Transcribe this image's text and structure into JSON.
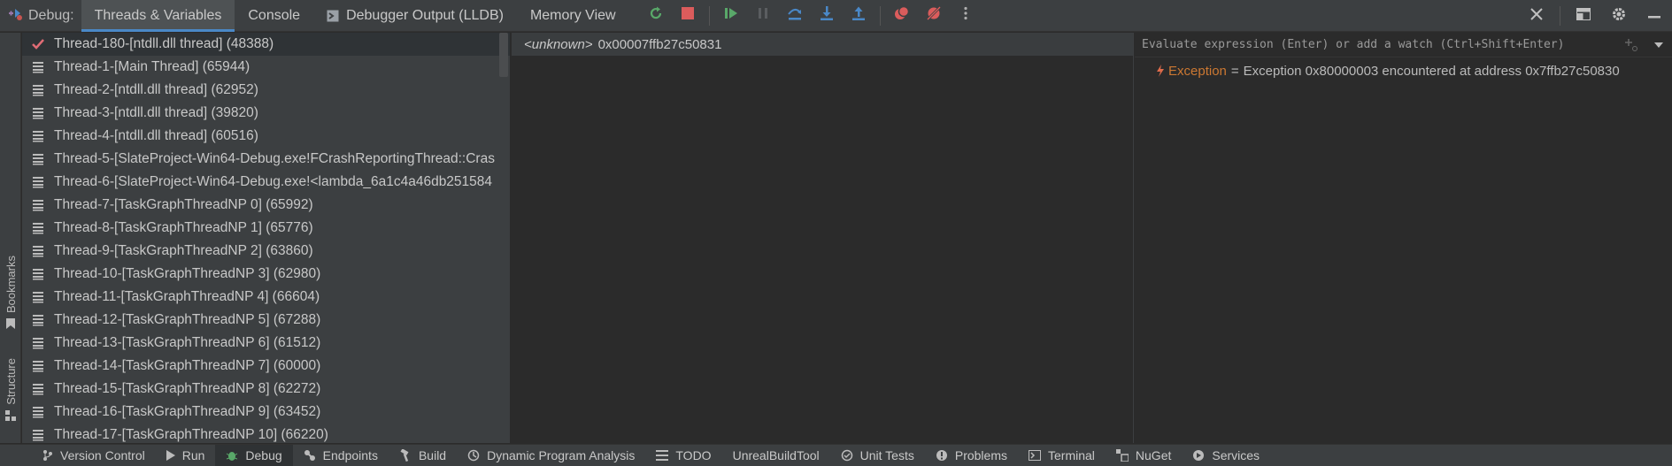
{
  "header": {
    "title": "Debug:",
    "tabs": [
      {
        "label": "Threads & Variables",
        "active": true
      },
      {
        "label": "Console"
      },
      {
        "label": "Debugger Output (LLDB)",
        "icon": "console-output-icon"
      },
      {
        "label": "Memory View"
      }
    ]
  },
  "left_strip": {
    "bookmarks": "Bookmarks",
    "structure": "Structure"
  },
  "threads": {
    "items": [
      {
        "label": "Thread-180-[ntdll.dll thread] (48388)",
        "selected": true
      },
      {
        "label": "Thread-1-[Main Thread] (65944)"
      },
      {
        "label": "Thread-2-[ntdll.dll thread] (62952)"
      },
      {
        "label": "Thread-3-[ntdll.dll thread] (39820)"
      },
      {
        "label": "Thread-4-[ntdll.dll thread] (60516)"
      },
      {
        "label": "Thread-5-[SlateProject-Win64-Debug.exe!FCrashReportingThread::Cras"
      },
      {
        "label": "Thread-6-[SlateProject-Win64-Debug.exe!<lambda_6a1c4a46db251584"
      },
      {
        "label": "Thread-7-[TaskGraphThreadNP 0] (65992)"
      },
      {
        "label": "Thread-8-[TaskGraphThreadNP 1] (65776)"
      },
      {
        "label": "Thread-9-[TaskGraphThreadNP 2] (63860)"
      },
      {
        "label": "Thread-10-[TaskGraphThreadNP 3] (62980)"
      },
      {
        "label": "Thread-11-[TaskGraphThreadNP 4] (66604)"
      },
      {
        "label": "Thread-12-[TaskGraphThreadNP 5] (67288)"
      },
      {
        "label": "Thread-13-[TaskGraphThreadNP 6] (61512)"
      },
      {
        "label": "Thread-14-[TaskGraphThreadNP 7] (60000)"
      },
      {
        "label": "Thread-15-[TaskGraphThreadNP 8] (62272)"
      },
      {
        "label": "Thread-16-[TaskGraphThreadNP 9] (63452)"
      },
      {
        "label": "Thread-17-[TaskGraphThreadNP 10] (66220)"
      }
    ]
  },
  "frames": {
    "items": [
      {
        "func": "<unknown>",
        "address": "0x00007ffb27c50831"
      }
    ]
  },
  "variables": {
    "eval_placeholder": "Evaluate expression (Enter) or add a watch (Ctrl+Shift+Enter)",
    "items": [
      {
        "name": "Exception",
        "eq": "=",
        "value": "Exception 0x80000003 encountered at address 0x7ffb27c50830"
      }
    ]
  },
  "bottom_bar": {
    "tabs": [
      {
        "label": "Version Control",
        "icon": "branch-icon"
      },
      {
        "label": "Run",
        "icon": "run-icon"
      },
      {
        "label": "Debug",
        "icon": "bug-icon",
        "active": true
      },
      {
        "label": "Endpoints",
        "icon": "endpoints-icon"
      },
      {
        "label": "Build",
        "icon": "hammer-icon"
      },
      {
        "label": "Dynamic Program Analysis",
        "icon": "analysis-icon"
      },
      {
        "label": "TODO",
        "icon": "list-icon"
      },
      {
        "label": "UnrealBuildTool",
        "icon": ""
      },
      {
        "label": "Unit Tests",
        "icon": "unit-tests-icon"
      },
      {
        "label": "Problems",
        "icon": "problems-icon"
      },
      {
        "label": "Terminal",
        "icon": "terminal-icon"
      },
      {
        "label": "NuGet",
        "icon": "nuget-icon"
      },
      {
        "label": "Services",
        "icon": "services-icon"
      }
    ]
  },
  "colors": {
    "accent": "#4a88c7",
    "exception_name": "#cc7832",
    "resume_green": "#59a869",
    "stop_red": "#db5c5c"
  }
}
